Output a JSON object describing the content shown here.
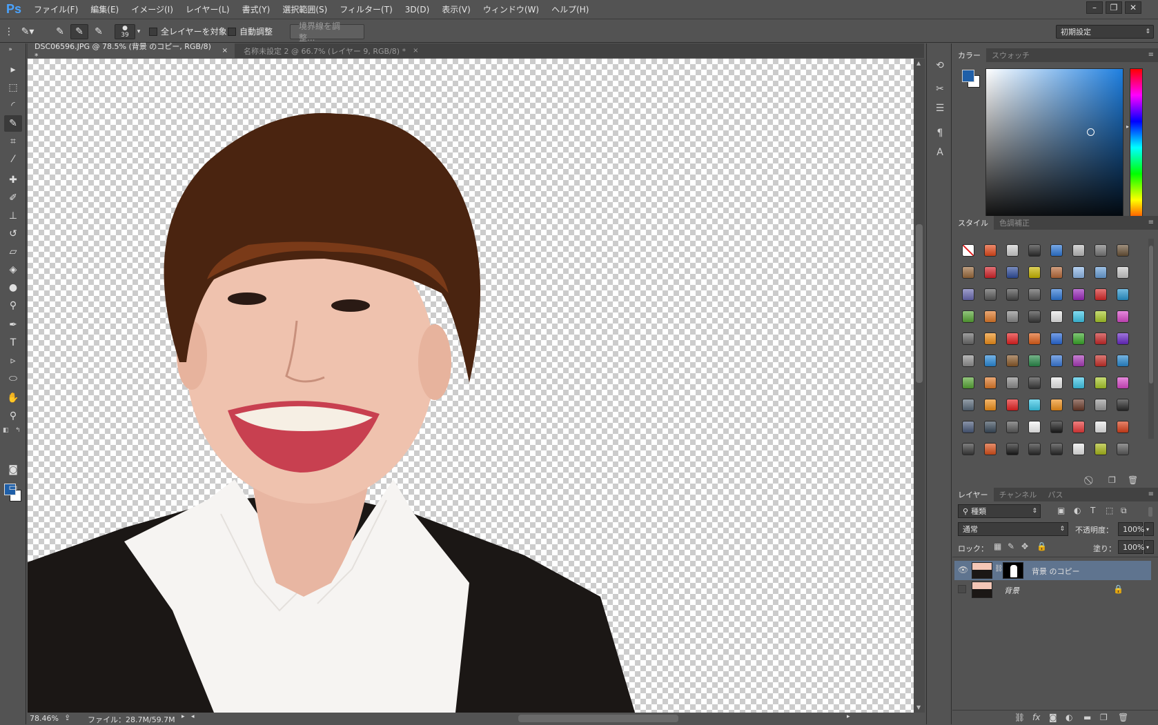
{
  "app": {
    "logo": "Ps"
  },
  "menu": [
    "ファイル(F)",
    "編集(E)",
    "イメージ(I)",
    "レイヤー(L)",
    "書式(Y)",
    "選択範囲(S)",
    "フィルター(T)",
    "3D(D)",
    "表示(V)",
    "ウィンドウ(W)",
    "ヘルプ(H)"
  ],
  "window_controls": {
    "minimize": "–",
    "restore": "❐",
    "close": "✕"
  },
  "options": {
    "brush_size": "39",
    "sample_all_layers": "全レイヤーを対象",
    "auto_enhance": "自動調整",
    "refine_edge": "境界線を調整...",
    "workspace": "初期設定"
  },
  "tabs": [
    {
      "label": "DSC06596.JPG @ 78.5% (背景 のコピー, RGB/8) *",
      "close": "×"
    },
    {
      "label": "名称未設定 2 @ 66.7% (レイヤー 9, RGB/8) *",
      "close": "×"
    }
  ],
  "status": {
    "zoom": "78.46%",
    "file": "ファイル：28.7M/59.7M"
  },
  "color_panel": {
    "tabs": [
      "カラー",
      "スウォッチ"
    ],
    "foreground": "#1f5fa8",
    "background": "#ffffff",
    "hue_base": "#1e7fe0"
  },
  "styles_panel": {
    "tabs": [
      "スタイル",
      "色調補正"
    ],
    "swatches": [
      "#ffffff",
      "#e24a1c",
      "#cfcfcf",
      "#2d2d2d",
      "#2f78d6",
      "#bdbdbd",
      "#777777",
      "#6a5338",
      "#9a6a3c",
      "#d4242a",
      "#304e9c",
      "#c8b600",
      "#b86a3a",
      "#8fb8e8",
      "#6aa0d8",
      "#c9c9c9",
      "#6a6ab0",
      "#5a5a5a",
      "#4a4a4a",
      "#5a5a5a",
      "#2f78d6",
      "#9a2abb",
      "#d82a2a",
      "#2a96cf",
      "#58a636",
      "#e07a2a",
      "#8a8a8a",
      "#3a3a3a",
      "#e8e8e8",
      "#3fc7e8",
      "#a8c82a",
      "#d84ac8",
      "#6a6a6a",
      "#ef8f1a",
      "#e62222",
      "#e0601a",
      "#2a6ad8",
      "#3aa82a",
      "#c82a2a",
      "#6a2ac8",
      "#909090",
      "#2a8ad8",
      "#8a5a2a",
      "#2a8a4a",
      "#3a7ad8",
      "#a83ab8",
      "#c8302a",
      "#2a8ad0",
      "#58a636",
      "#e07a2a",
      "#8a8a8a",
      "#3a3a3a",
      "#e8e8e8",
      "#3fc7e8",
      "#a8c82a",
      "#d84ac8",
      "#5a6a7a",
      "#ef8f1a",
      "#e62222",
      "#3ac8e8",
      "#f0901a",
      "#6a3a2a",
      "#9a9a9a",
      "#2a2a2a",
      "#4a5a7a",
      "#3a4a5a",
      "#5a5a5a",
      "#f4f4f4",
      "#1a1a1a",
      "#e83a3a",
      "#e8e8e8",
      "#d8401a",
      "#3a3a3a",
      "#d8501a",
      "#1a1a1a",
      "#2a2a2a",
      "#2a2a2a",
      "#e8e8e8",
      "#a8b81a",
      "#5a5a5a"
    ]
  },
  "layers_panel": {
    "tabs": [
      "レイヤー",
      "チャンネル",
      "パス"
    ],
    "filter": "種類",
    "blend_mode": "通常",
    "opacity_label": "不透明度：",
    "opacity": "100%",
    "lock_label": "ロック：",
    "fill_label": "塗り：",
    "fill": "100%",
    "layers": [
      {
        "name": "背景 のコピー",
        "visible": true,
        "selected": true
      },
      {
        "name": "背景",
        "visible": false,
        "selected": false
      }
    ]
  }
}
